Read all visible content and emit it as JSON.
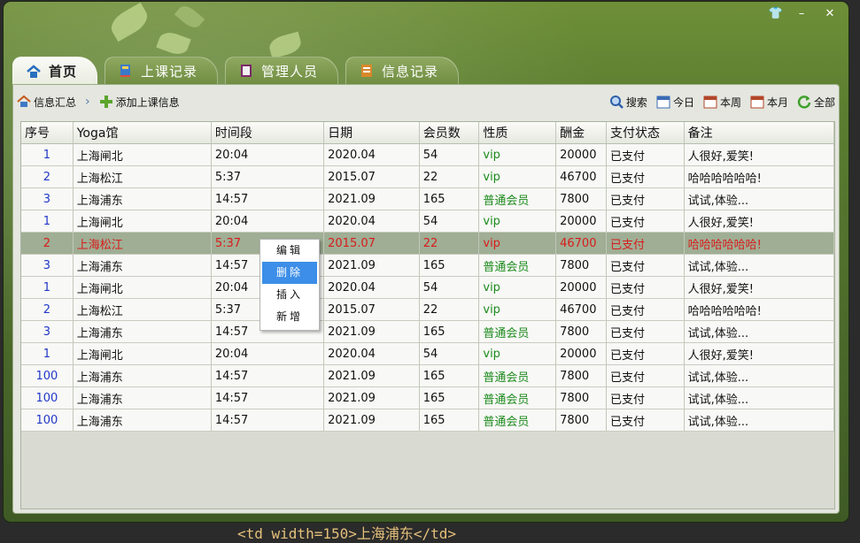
{
  "window": {
    "controls": [
      "👕",
      "–",
      "✕"
    ]
  },
  "tabs": [
    {
      "label": "首页",
      "icon": "home-icon",
      "active": true
    },
    {
      "label": "上课记录",
      "icon": "book-icon",
      "active": false
    },
    {
      "label": "管理人员",
      "icon": "folder-book-icon",
      "active": false
    },
    {
      "label": "信息记录",
      "icon": "notes-icon",
      "active": false
    }
  ],
  "toolbar": {
    "breadcrumb_home": "信息汇总",
    "add_label": "添加上课信息",
    "search_label": "搜索",
    "today_label": "今日",
    "week_label": "本周",
    "month_label": "本月",
    "all_label": "全部"
  },
  "table": {
    "columns": [
      "序号",
      "Yoga馆",
      "时间段",
      "日期",
      "会员数",
      "性质",
      "酬金",
      "支付状态",
      "备注"
    ],
    "rows": [
      [
        "1",
        "上海闸北",
        "20:04",
        "2020.04",
        "54",
        "vip",
        "20000",
        "已支付",
        "人很好,爱笑!"
      ],
      [
        "2",
        "上海松江",
        "5:37",
        "2015.07",
        "22",
        "vip",
        "46700",
        "已支付",
        "哈哈哈哈哈哈!"
      ],
      [
        "3",
        "上海浦东",
        "14:57",
        "2021.09",
        "165",
        "普通会员",
        "7800",
        "已支付",
        "试试,体验..."
      ],
      [
        "1",
        "上海闸北",
        "20:04",
        "2020.04",
        "54",
        "vip",
        "20000",
        "已支付",
        "人很好,爱笑!"
      ],
      [
        "2",
        "上海松江",
        "5:37",
        "2015.07",
        "22",
        "vip",
        "46700",
        "已支付",
        "哈哈哈哈哈哈!"
      ],
      [
        "3",
        "上海浦东",
        "14:57",
        "2021.09",
        "165",
        "普通会员",
        "7800",
        "已支付",
        "试试,体验..."
      ],
      [
        "1",
        "上海闸北",
        "20:04",
        "2020.04",
        "54",
        "vip",
        "20000",
        "已支付",
        "人很好,爱笑!"
      ],
      [
        "2",
        "上海松江",
        "5:37",
        "2015.07",
        "22",
        "vip",
        "46700",
        "已支付",
        "哈哈哈哈哈哈!"
      ],
      [
        "3",
        "上海浦东",
        "14:57",
        "2021.09",
        "165",
        "普通会员",
        "7800",
        "已支付",
        "试试,体验..."
      ],
      [
        "1",
        "上海闸北",
        "20:04",
        "2020.04",
        "54",
        "vip",
        "20000",
        "已支付",
        "人很好,爱笑!"
      ],
      [
        "100",
        "上海浦东",
        "14:57",
        "2021.09",
        "165",
        "普通会员",
        "7800",
        "已支付",
        "试试,体验..."
      ],
      [
        "100",
        "上海浦东",
        "14:57",
        "2021.09",
        "165",
        "普通会员",
        "7800",
        "已支付",
        "试试,体验..."
      ],
      [
        "100",
        "上海浦东",
        "14:57",
        "2021.09",
        "165",
        "普通会员",
        "7800",
        "已支付",
        "试试,体验..."
      ]
    ],
    "selected_row": 4
  },
  "context_menu": {
    "items": [
      "编辑",
      "删除",
      "插入",
      "新增"
    ],
    "hovered": 1
  },
  "background_code": {
    "bottom": "<td width=150>上海浦东</td>"
  },
  "colors": {
    "selected_text": "#d81c1c",
    "index_text": "#2238c9",
    "green_text": "#1c8a1c",
    "menu_hover": "#3c8ee8"
  }
}
